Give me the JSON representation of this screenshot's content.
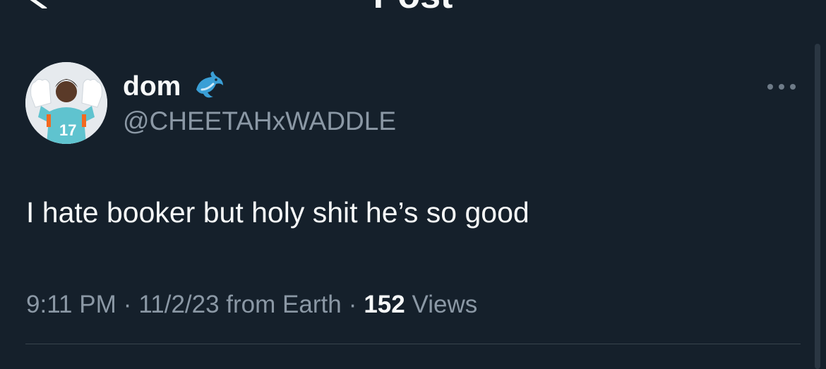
{
  "header": {
    "title": "Post",
    "back_icon": "chevron-left-icon"
  },
  "author": {
    "display_name": "dom",
    "badge_emoji": "🐬",
    "handle": "@CHEETAHxWADDLE",
    "avatar_icon": "profile-photo"
  },
  "more_icon": "ellipsis-icon",
  "tweet": {
    "text": "I hate booker but holy shit he’s so good"
  },
  "meta": {
    "time": "9:11 PM",
    "separator": "·",
    "date_source": "11/2/23 from Earth",
    "views_count": "152",
    "views_label": "Views"
  },
  "colors": {
    "background": "#15202b",
    "primary_text": "#f7f9f9",
    "secondary_text": "#8b98a5",
    "divider": "#38444d"
  }
}
